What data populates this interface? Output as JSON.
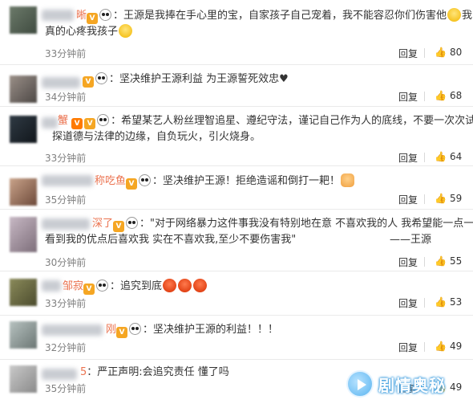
{
  "actions": {
    "reply_label": "回复",
    "like_icon": "thumbs-up-icon"
  },
  "comments": [
    {
      "name": "晰",
      "text_lines": [
        "王源是我捧在手心里的宝，自家孩子自己宠着，我不能容忍你们伤害他",
        "我",
        "真的心疼我孩子"
      ],
      "time": "33分钟前",
      "likes": "80"
    },
    {
      "name": "",
      "text_lines": [
        "坚决维护王源利益 为王源誓死效忠"
      ],
      "time": "34分钟前",
      "likes": "68"
    },
    {
      "name": "蟹",
      "text_lines": [
        "希望某艺人粉丝理智追星、遵纪守法，谨记自己作为人的底线，不要一次次试",
        "探道德与法律的边缘，自负玩火，引火烧身。"
      ],
      "time": "33分钟前",
      "likes": "64"
    },
    {
      "name": "称吃鱼",
      "text_lines": [
        "坚决维护王源！拒绝造谣和倒打一耙！"
      ],
      "time": "35分钟前",
      "likes": "59"
    },
    {
      "name": "深了",
      "text_lines": [
        "\"对于网络暴力这件事我没有特别地在意 不喜欢我的人 我希望能一点一滴",
        "看到我的优点后喜欢我 实在不喜欢我,至少不要伤害我\"",
        "——王源"
      ],
      "time": "30分钟前",
      "likes": "55"
    },
    {
      "name": "邹寂",
      "text_lines": [
        "追究到底"
      ],
      "time": "33分钟前",
      "likes": "53"
    },
    {
      "name": "刚",
      "text_lines": [
        "坚决维护王源的利益！！！"
      ],
      "time": "32分钟前",
      "likes": "49"
    },
    {
      "name": "5",
      "text_lines": [
        "严正声明:会追究责任 懂了吗"
      ],
      "time": "35分钟前",
      "likes": "49"
    }
  ],
  "watermark": {
    "text": "剧情奥秘"
  }
}
